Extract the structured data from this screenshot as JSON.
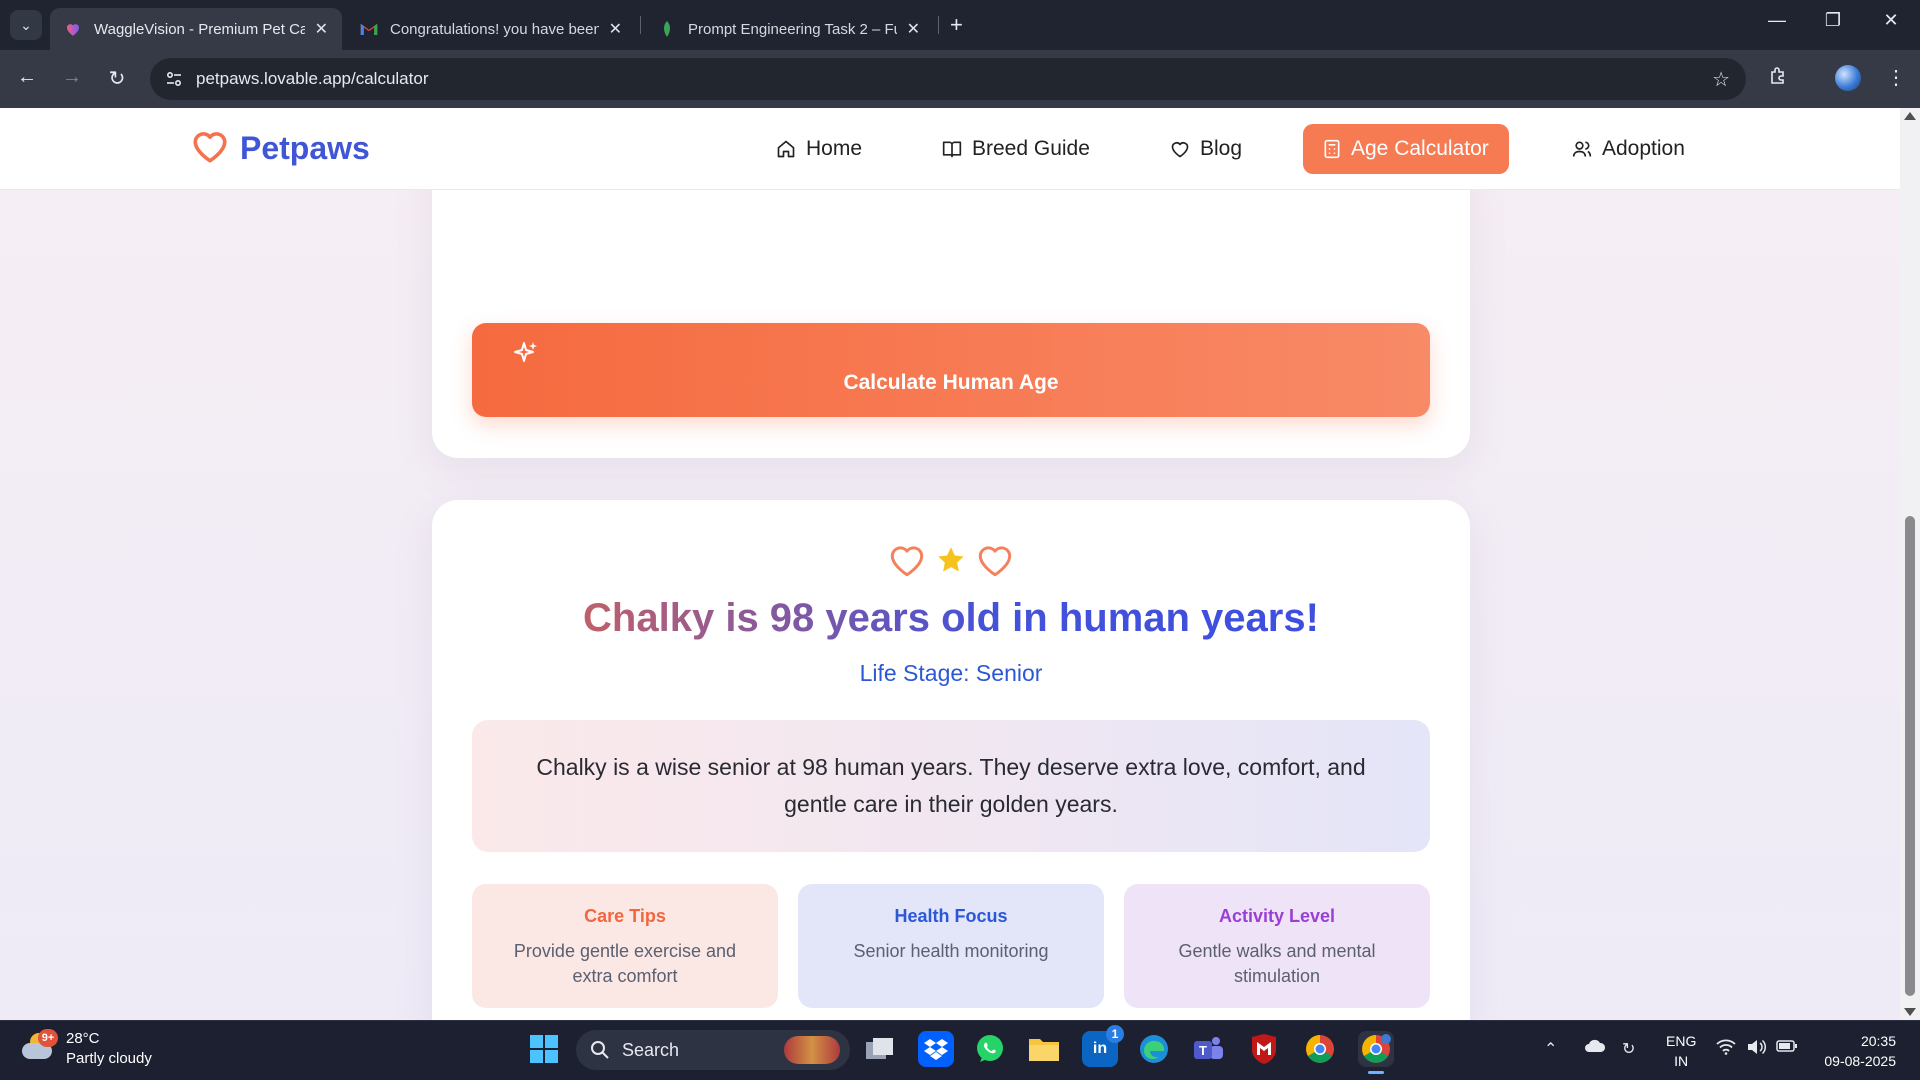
{
  "browser": {
    "tabs": [
      {
        "title": "WaggleVision - Premium Pet Ca",
        "active": true,
        "favicon": "heart-gradient-icon"
      },
      {
        "title": "Congratulations! you have been",
        "active": false,
        "favicon": "gmail-icon"
      },
      {
        "title": "Prompt Engineering Task 2 – Fu",
        "active": false,
        "favicon": "leaf-icon"
      }
    ],
    "url": "petpaws.lovable.app/calculator"
  },
  "site": {
    "logo_text": "Petpaws",
    "nav": [
      {
        "label": "Home",
        "icon": "home-icon"
      },
      {
        "label": "Breed Guide",
        "icon": "book-icon"
      },
      {
        "label": "Blog",
        "icon": "heart-icon"
      },
      {
        "label": "Age Calculator",
        "icon": "calculator-icon",
        "active": true
      },
      {
        "label": "Adoption",
        "icon": "users-icon"
      }
    ],
    "brand_color": "#3f56d6",
    "accent_color": "#f67a52"
  },
  "calculator": {
    "button_label": "Calculate Human Age"
  },
  "result": {
    "title": "Chalky is 98 years old in human years!",
    "life_stage": "Life Stage: Senior",
    "description": "Chalky is a wise senior at 98 human years. They deserve extra love, comfort, and gentle care in their golden years.",
    "cards": [
      {
        "heading": "Care Tips",
        "body": "Provide gentle exercise and extra comfort"
      },
      {
        "heading": "Health Focus",
        "body": "Senior health monitoring"
      },
      {
        "heading": "Activity Level",
        "body": "Gentle walks and mental stimulation"
      }
    ]
  },
  "taskbar": {
    "weather_badge": "9+",
    "temperature": "28°C",
    "weather": "Partly cloudy",
    "search_placeholder": "Search",
    "linkedin_badge": "1",
    "lang_line1": "ENG",
    "lang_line2": "IN",
    "time": "20:35",
    "date": "09-08-2025"
  }
}
